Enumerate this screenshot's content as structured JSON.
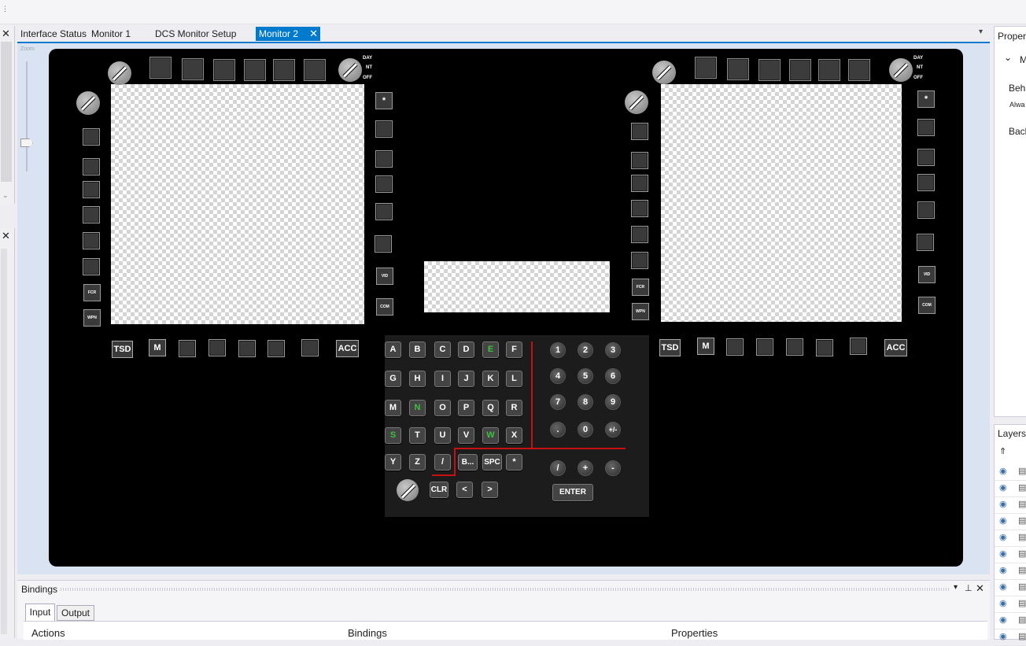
{
  "tabs": [
    {
      "label": "Interface Status"
    },
    {
      "label": "Monitor 1"
    },
    {
      "label": "DCS Monitor Setup"
    },
    {
      "label": "Monitor 2",
      "active": true
    }
  ],
  "zoom_label": "Zoom",
  "right_panel": {
    "title": "Proper",
    "row1": "M",
    "behavior_label": "Beha",
    "behavior_value": "Alwa",
    "background_label": "Back",
    "layers_title": "Layers"
  },
  "mfd": {
    "brightness": {
      "day": "DAY",
      "nt": "NT",
      "off": "OFF"
    },
    "bottom_left_label": "TSD",
    "bottom_m_label": "M",
    "bottom_right_label": "ACC",
    "left_small_1": "FCR",
    "left_small_2": "WPN",
    "right_star": "*",
    "right_small_1": "VID",
    "right_small_2": "COM"
  },
  "keyboard": {
    "letters_row1": [
      "A",
      "B",
      "C",
      "D",
      "E",
      "F"
    ],
    "letters_row2": [
      "G",
      "H",
      "I",
      "J",
      "K",
      "L"
    ],
    "letters_row3": [
      "M",
      "N",
      "O",
      "P",
      "Q",
      "R"
    ],
    "letters_row4": [
      "S",
      "T",
      "U",
      "V",
      "W",
      "X"
    ],
    "letters_row5": [
      "Y",
      "Z",
      "/",
      "B...",
      "SPC",
      "*"
    ],
    "bottom_row": [
      "CLR",
      "<",
      ">"
    ],
    "numpad_row1": [
      "1",
      "2",
      "3"
    ],
    "numpad_row2": [
      "4",
      "5",
      "6"
    ],
    "numpad_row3": [
      "7",
      "8",
      "9"
    ],
    "numpad_row4": [
      ".",
      "0",
      "+/-"
    ],
    "ops_row": [
      "/",
      "+",
      "-"
    ],
    "enter_label": "ENTER",
    "green_keys": [
      "E",
      "N",
      "S",
      "W"
    ]
  },
  "bindings": {
    "title": "Bindings",
    "tabs": [
      "Input",
      "Output"
    ],
    "columns": [
      "Actions",
      "Bindings",
      "Properties"
    ]
  },
  "colors": {
    "accent": "#007acc",
    "canvas": "#000000",
    "green_key": "#3ec13e",
    "red_line": "#c81010"
  }
}
